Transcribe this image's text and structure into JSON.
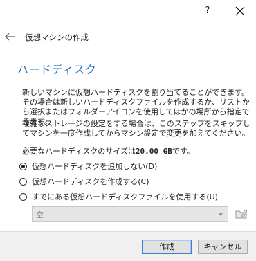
{
  "titlebar": {
    "help_label": "?"
  },
  "header": {
    "wizard_title": "仮想マシンの作成"
  },
  "page": {
    "title": "ハードディスク",
    "description1": "新しいマシンに仮想ハードディスクを割り当てることができます。その場合は新しいハードディスクファイルを作成するか、リストから選択またはフォルダーアイコンを使用してほかの場所から指定できます。",
    "description2": "複雑なストレージの設定をする場合は、このステップをスキップしてマシンを一度作成してからマシン設定で変更を加えてください。",
    "size_prefix": "必要なハードディスクのサイズは",
    "size_value": "20.00 GB",
    "size_suffix": "です。"
  },
  "options": [
    {
      "label": "仮想ハードディスクを追加しない(D)",
      "selected": true
    },
    {
      "label": "仮想ハードディスクを作成する(C)",
      "selected": false
    },
    {
      "label": "すでにある仮想ハードディスクファイルを使用する(U)",
      "selected": false
    }
  ],
  "disk_combo": {
    "value": "空",
    "enabled": false
  },
  "buttons": {
    "create": "作成",
    "cancel": "キャンセル"
  },
  "colors": {
    "title_blue": "#1f6fb8",
    "accent_border": "#3c7fd4"
  }
}
